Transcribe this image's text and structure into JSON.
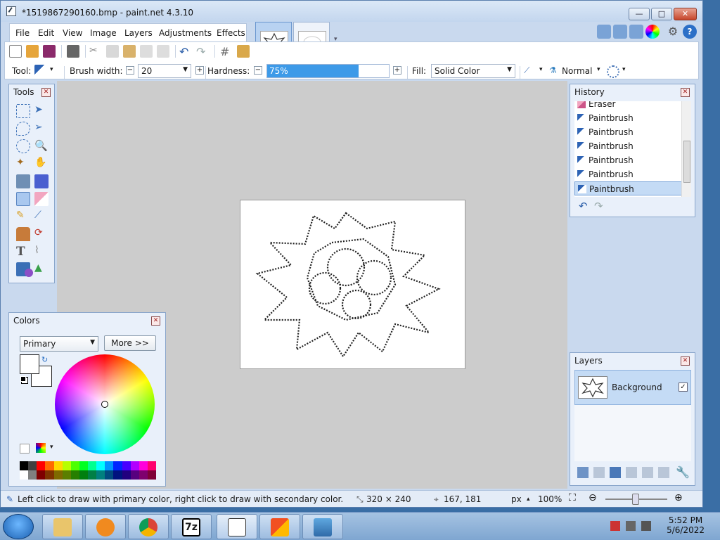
{
  "window": {
    "title": "*1519867290160.bmp - paint.net 4.3.10",
    "minimize": "—",
    "maximize": "□",
    "close": "✕"
  },
  "menu": [
    "File",
    "Edit",
    "View",
    "Image",
    "Layers",
    "Adjustments",
    "Effects"
  ],
  "toolbar": {
    "tool_label": "Tool:",
    "brush_width_label": "Brush width:",
    "brush_width_value": "20",
    "hardness_label": "Hardness:",
    "hardness_value": "75%",
    "hardness_fraction": 0.75,
    "fill_label": "Fill:",
    "fill_value": "Solid Color",
    "blend_mode": "Normal"
  },
  "panels": {
    "tools": {
      "title": "Tools"
    },
    "history": {
      "title": "History",
      "items": [
        "Eraser",
        "Paintbrush",
        "Paintbrush",
        "Paintbrush",
        "Paintbrush",
        "Paintbrush",
        "Paintbrush"
      ],
      "selected_index": 6
    },
    "colors": {
      "title": "Colors",
      "mode": "Primary",
      "more_button": "More >>",
      "primary_color": "#ffffff",
      "secondary_color": "#ffffff"
    },
    "layers": {
      "title": "Layers",
      "items": [
        {
          "name": "Background",
          "visible": true
        }
      ]
    }
  },
  "status": {
    "hint": "Left click to draw with primary color, right click to draw with secondary color.",
    "image_size": "320 × 240",
    "cursor_position": "167, 181",
    "units": "px",
    "zoom": "100%"
  },
  "taskbar": {
    "time": "5:52 PM",
    "date": "5/6/2022"
  },
  "colors": {
    "accent": "#3d9ae8",
    "panel_bg": "#e9f0fa",
    "workspace_bg": "#cccccc"
  }
}
